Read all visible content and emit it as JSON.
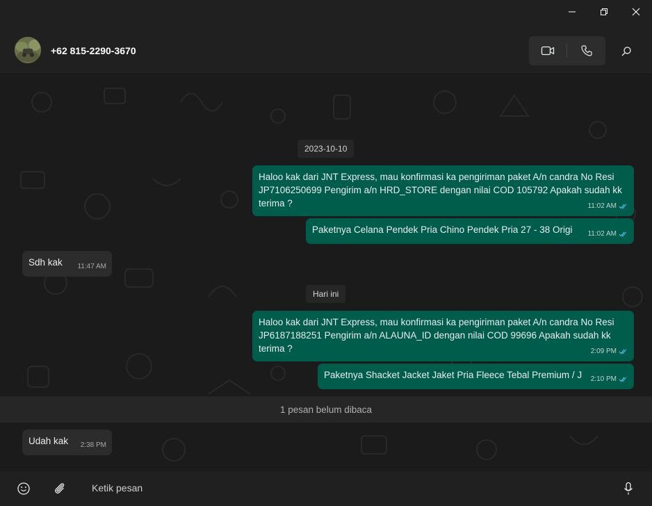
{
  "window": {
    "minimize_icon": "minimize-icon",
    "maximize_icon": "restore-icon",
    "close_icon": "close-icon"
  },
  "header": {
    "contact_name": "+62 815-2290-3670",
    "video_icon": "video-call-icon",
    "voice_icon": "voice-call-icon",
    "search_icon": "search-icon"
  },
  "messages": [
    {
      "type": "date",
      "text": "2023-10-10"
    },
    {
      "type": "out",
      "text": "Haloo kak dari JNT Express, mau konfirmasi ka pengiriman paket A/n candra No Resi JP7106250699 Pengirim a/n HRD_STORE dengan nilai COD 105792 Apakah sudah kk terima ?",
      "time": "11:02 AM",
      "status": "read"
    },
    {
      "type": "out",
      "text": "Paketnya Celana Pendek Pria Chino Pendek Pria 27 - 38 Origi",
      "time": "11:02 AM",
      "status": "read"
    },
    {
      "type": "in",
      "text": "Sdh kak",
      "time": "11:47 AM"
    },
    {
      "type": "date",
      "text": "Hari ini"
    },
    {
      "type": "out",
      "text": "Haloo kak dari JNT Express, mau konfirmasi ka pengiriman paket A/n candra No Resi JP6187188251 Pengirim a/n ALAUNA_ID dengan nilai COD 99696 Apakah sudah kk terima ?",
      "time": "2:09 PM",
      "status": "read"
    },
    {
      "type": "out",
      "text": "Paketnya Shacket Jacket Jaket Pria Fleece Tebal Premium / J",
      "time": "2:10 PM",
      "status": "read"
    },
    {
      "type": "unread",
      "text": "1 pesan belum dibaca"
    },
    {
      "type": "in",
      "text": "Udah kak",
      "time": "2:38 PM"
    }
  ],
  "composer": {
    "emoji_icon": "emoji-icon",
    "attach_icon": "attach-icon",
    "placeholder": "Ketik pesan",
    "mic_icon": "microphone-icon"
  },
  "colors": {
    "background": "#1b1b1b",
    "outgoing_bubble": "#005c4b",
    "incoming_bubble": "#2c2c2c",
    "read_tick": "#53bdeb"
  }
}
